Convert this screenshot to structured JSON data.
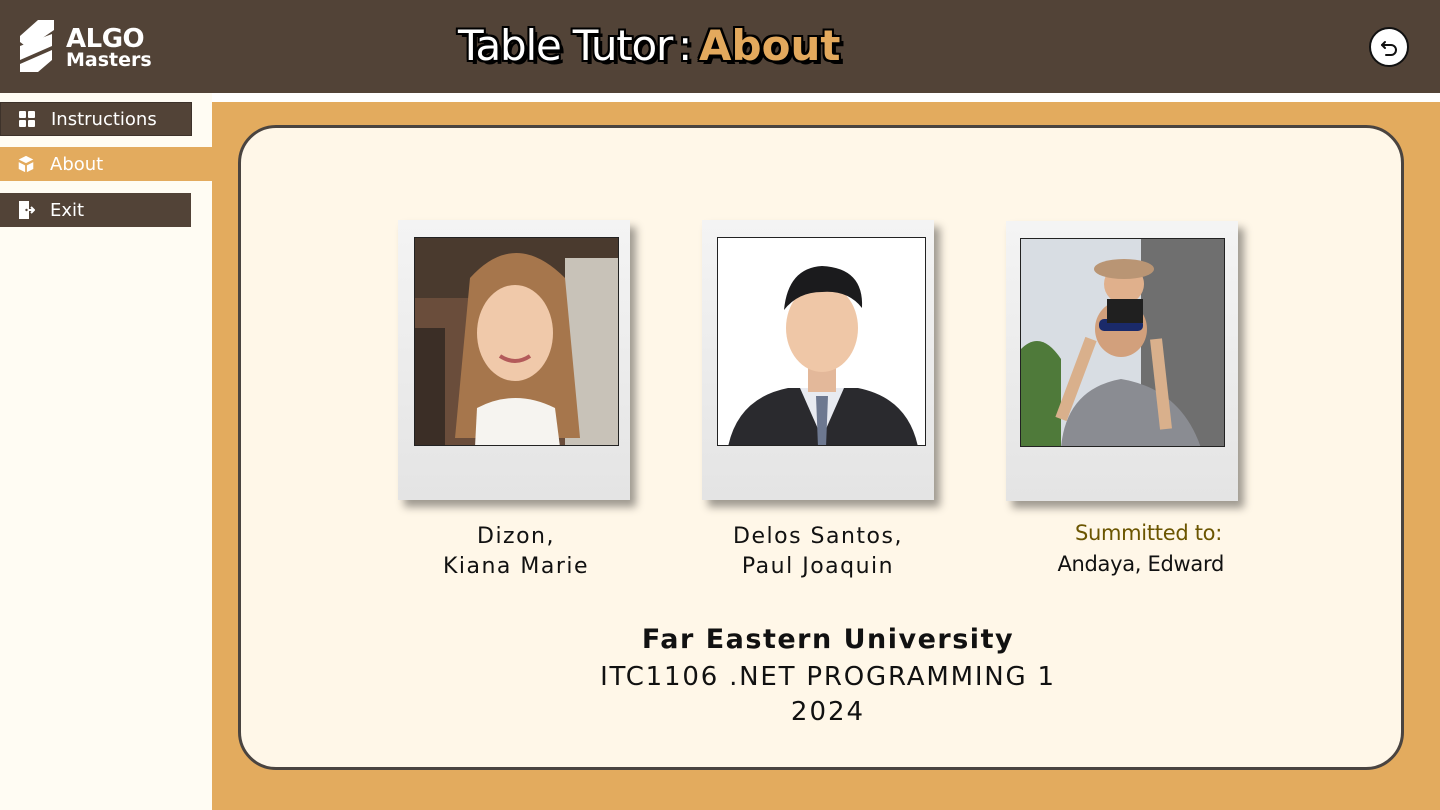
{
  "header": {
    "logo": {
      "line1": "ALGO",
      "line2": "Masters",
      "icon": "algo-masters-logo"
    },
    "title": {
      "app": "Table Tutor",
      "separator": ":",
      "page": "About"
    },
    "back_button": {
      "icon": "undo-arrow-icon"
    }
  },
  "sidebar": {
    "items": [
      {
        "label": "Instructions",
        "icon": "grid-icon",
        "active": false
      },
      {
        "label": "About",
        "icon": "box-icon",
        "active": true
      },
      {
        "label": "Exit",
        "icon": "exit-door-icon",
        "active": false
      }
    ]
  },
  "about": {
    "members": [
      {
        "line1": "Dizon,",
        "line2": "Kiana Marie"
      },
      {
        "line1": "Delos Santos,",
        "line2": "Paul Joaquin"
      }
    ],
    "submitted": {
      "label": "Summitted to:",
      "name": "Andaya, Edward"
    },
    "university": "Far Eastern University",
    "course": "ITC1106 .NET PROGRAMMING 1",
    "year": "2024"
  },
  "colors": {
    "header_bg": "#524337",
    "accent": "#e3ab5e",
    "card_bg": "#fff7e8",
    "sidebar_bg": "#fffcf3",
    "submitted_label": "#6b5500"
  }
}
